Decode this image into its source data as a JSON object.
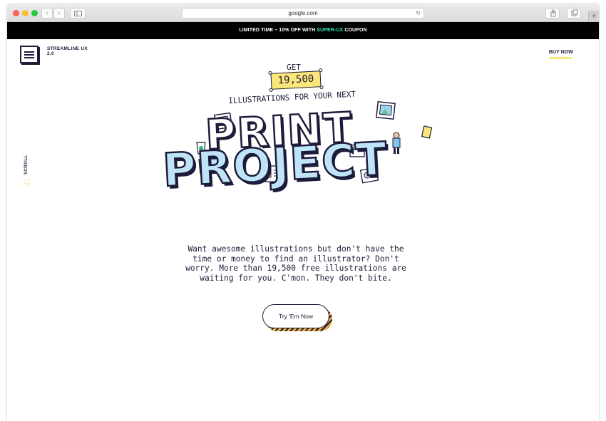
{
  "browser": {
    "url": "google.com"
  },
  "promo": {
    "prefix": "LIMITED TIME – 10% OFF WITH ",
    "code": "SUPER-UX",
    "suffix": " COUPON",
    "code_color": "#2ee6b6"
  },
  "header": {
    "logo_line1": "STREAMLINE UX",
    "logo_line2": "2.0",
    "buy_now": "BUY NOW"
  },
  "scroll": {
    "label": "SCROLL"
  },
  "hero": {
    "get": "GET",
    "count": "19,500",
    "subline": "ILLUSTRATIONS FOR YOUR NEXT",
    "word1": "PRINT",
    "word2": "PROJECT",
    "accent_yellow": "#fbe67a",
    "accent_blue": "#bfe4f7"
  },
  "main": {
    "description": "Want awesome illustrations but don't have the time or money to find an illustrator? Don't worry. More than 19,500 free illustrations are waiting for you. C'mon. They don't bite.",
    "cta_label": "Try 'Em Now"
  },
  "icons": [
    "back-icon",
    "forward-icon",
    "sidebar-icon",
    "reload-icon",
    "share-icon",
    "tabs-icon",
    "new-tab-icon",
    "menu-logo-icon",
    "pointing-hand-icon"
  ]
}
